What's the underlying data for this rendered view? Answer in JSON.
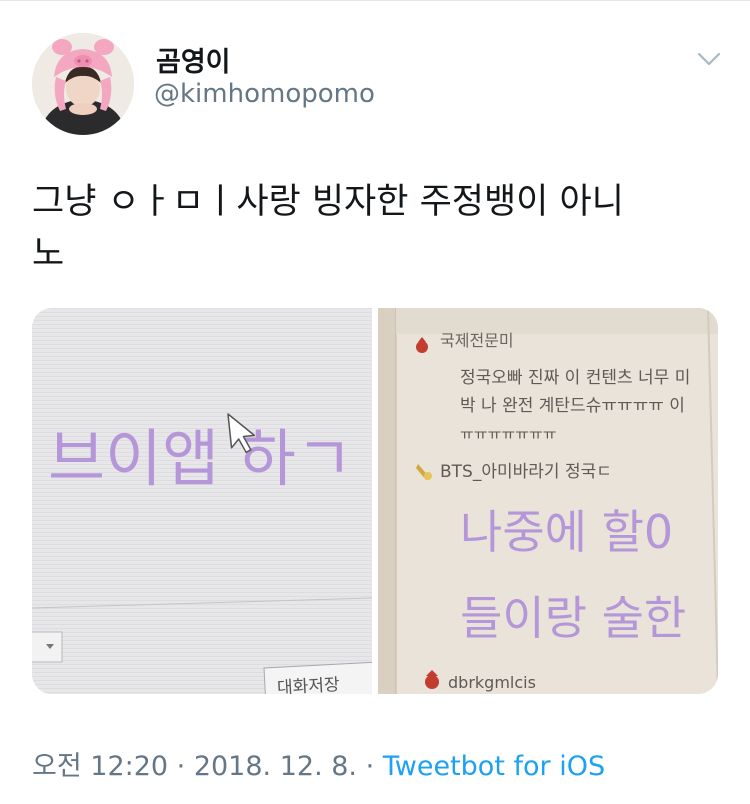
{
  "user": {
    "display_name": "곰영이",
    "handle": "@kimhomopomo",
    "avatar_icon": "avatar-bunny-hat",
    "menu_icon": "chevron-down-icon"
  },
  "tweet": {
    "text_line1": "그냥 ㅇㅏㅁㅣ사랑 빙자한 주정뱅이 아니",
    "text_line2": "노"
  },
  "photos": {
    "left": {
      "screen_text": "브이앱 하ㄱ",
      "button_text": "대화저장"
    },
    "right": {
      "top_cut_text": "국제전문미",
      "chat_line1": "정국오빠 진짜 이 컨텐츠 너무 미",
      "chat_line2": "박 나 완전 계탄드슈ㅠㅠㅠㅠ 이",
      "chat_line3": "ㅠㅠㅠㅠㅠㅠㅠ",
      "user1": "BTS_아미바라기 정국ㄷ",
      "big_line1": "나중에 할0",
      "big_line2": "들이랑 술한",
      "user2": "dbrkgmlcis"
    }
  },
  "footer": {
    "time": "오전 12:20",
    "sep1": " · ",
    "date": "2018. 12. 8.",
    "sep2": " · ",
    "source": "Tweetbot for iOS"
  },
  "colors": {
    "link": "#1da1f2",
    "secondary_text": "#657786",
    "purple_text": "#b596d8"
  }
}
